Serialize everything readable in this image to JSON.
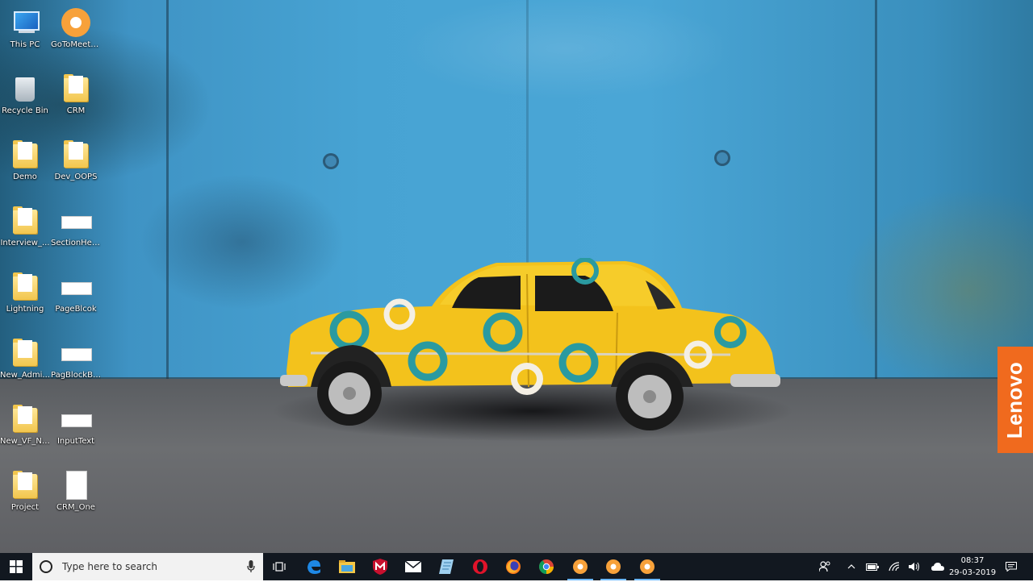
{
  "desktop": {
    "icons": [
      {
        "label": "This PC",
        "icon": "this-pc-icon"
      },
      {
        "label": "GoToMeeting",
        "icon": "gotomeeting-icon"
      },
      {
        "label": "Recycle Bin",
        "icon": "recycle-bin-icon"
      },
      {
        "label": "CRM",
        "icon": "folder-icon"
      },
      {
        "label": "Demo",
        "icon": "folder-icon"
      },
      {
        "label": "Dev_OOPS",
        "icon": "folder-icon"
      },
      {
        "label": "Interview_...",
        "icon": "folder-icon"
      },
      {
        "label": "SectionHea...",
        "icon": "file-icon"
      },
      {
        "label": "Lightning",
        "icon": "folder-icon"
      },
      {
        "label": "PageBlcok",
        "icon": "file-icon"
      },
      {
        "label": "New_Admi...",
        "icon": "folder-icon"
      },
      {
        "label": "PagBlockBu...",
        "icon": "file-icon"
      },
      {
        "label": "New_VF_No...",
        "icon": "folder-icon"
      },
      {
        "label": "InputText",
        "icon": "file-icon"
      },
      {
        "label": "Project",
        "icon": "folder-icon"
      },
      {
        "label": "CRM_One",
        "icon": "document-icon"
      }
    ]
  },
  "wallpaper": {
    "brand": "Lenovo",
    "brand_color": "#f06a1e"
  },
  "taskbar": {
    "search_placeholder": "Type here to search",
    "pinned": [
      "task-view-icon",
      "edge-icon",
      "file-explorer-icon",
      "mcafee-icon",
      "mail-icon",
      "notes-icon",
      "opera-icon",
      "firefox-icon",
      "chrome-icon",
      "gotomeeting-icon",
      "gotomeeting-icon",
      "gotomeeting-icon"
    ],
    "tray": [
      "people-icon",
      "chevron-up-icon",
      "battery-icon",
      "wifi-icon",
      "volume-icon",
      "onedrive-icon"
    ],
    "time": "08:37",
    "date": "29-03-2019",
    "accent": "#6cb8ff"
  }
}
